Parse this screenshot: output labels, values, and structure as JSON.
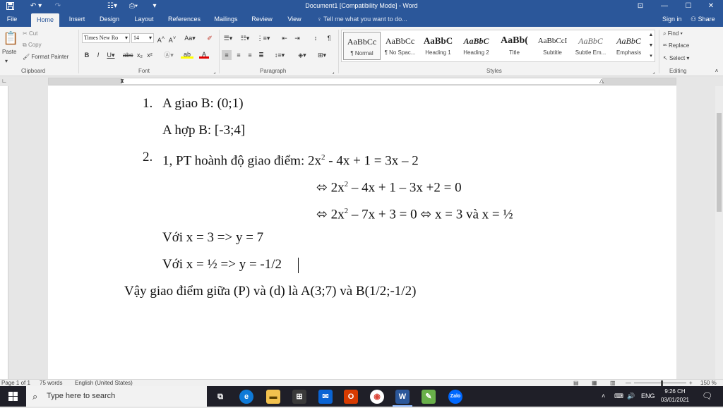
{
  "window": {
    "title": "Document1 [Compatibility Mode] - Word",
    "controls": {
      "restore_ribbon": "⊡",
      "minimize": "—",
      "maximize": "☐",
      "close": "✕"
    }
  },
  "quick_access": {
    "save_icon": "save-icon",
    "undo_icon": "undo-icon",
    "redo_icon": "redo-icon"
  },
  "tabs": [
    "File",
    "Home",
    "Insert",
    "Design",
    "Layout",
    "References",
    "Mailings",
    "Review",
    "View"
  ],
  "active_tab": "Home",
  "tell_me": "Tell me what you want to do...",
  "sign_in": "Sign in",
  "share": "Share",
  "ribbon": {
    "clipboard": {
      "paste": "Paste",
      "cut": "Cut",
      "copy": "Copy",
      "format_painter": "Format Painter",
      "label": "Clipboard"
    },
    "font": {
      "name": "Times New Ro",
      "size": "14",
      "label": "Font"
    },
    "paragraph": {
      "label": "Paragraph"
    },
    "styles": {
      "label": "Styles",
      "items": [
        {
          "preview": "AaBbCc",
          "name": "¶ Normal"
        },
        {
          "preview": "AaBbCc",
          "name": "¶ No Spac..."
        },
        {
          "preview": "AaBbC",
          "name": "Heading 1"
        },
        {
          "preview": "AaBbC",
          "name": "Heading 2"
        },
        {
          "preview": "AaBb(",
          "name": "Title"
        },
        {
          "preview": "AaBbCcI",
          "name": "Subtitle"
        },
        {
          "preview": "AaBbC",
          "name": "Subtle Em..."
        },
        {
          "preview": "AaBbC",
          "name": "Emphasis"
        }
      ]
    },
    "editing": {
      "find": "Find",
      "replace": "Replace",
      "select": "Select",
      "label": "Editing"
    }
  },
  "document": {
    "lines": [
      {
        "num": "1.",
        "text": "A giao B: (0;1)"
      },
      {
        "text": "A hợp B: [-3;4]"
      },
      {
        "num": "2.",
        "text_before": "1, PT hoành độ giao điểm: 2x",
        "sup": "2",
        "text_after": " - 4x + 1 = 3x – 2"
      },
      {
        "text_before": "⬄ 2x",
        "sup": "2",
        "text_after": " – 4x + 1 – 3x +2 = 0"
      },
      {
        "text_before": "⬄ 2x",
        "sup": "2",
        "text_after": " – 7x + 3 = 0 ⬄ x = 3 và x = ½"
      },
      {
        "text": "Với x = 3 => y = 7"
      },
      {
        "text": "Với x = ½ => y = -1/2"
      },
      {
        "text": "Vậy giao điểm giữa (P) và (d) là A(3;7) và B(1/2;-1/2)"
      }
    ]
  },
  "status": {
    "page": "Page 1 of 1",
    "words": "75 words",
    "language": "English (United States)",
    "zoom": "150 %"
  },
  "taskbar": {
    "search_placeholder": "Type here to search",
    "language": "ENG",
    "time": "9:26 CH",
    "date": "03/01/2021"
  },
  "colors": {
    "word_blue": "#2b579a",
    "taskbar": "#1f1f28"
  }
}
